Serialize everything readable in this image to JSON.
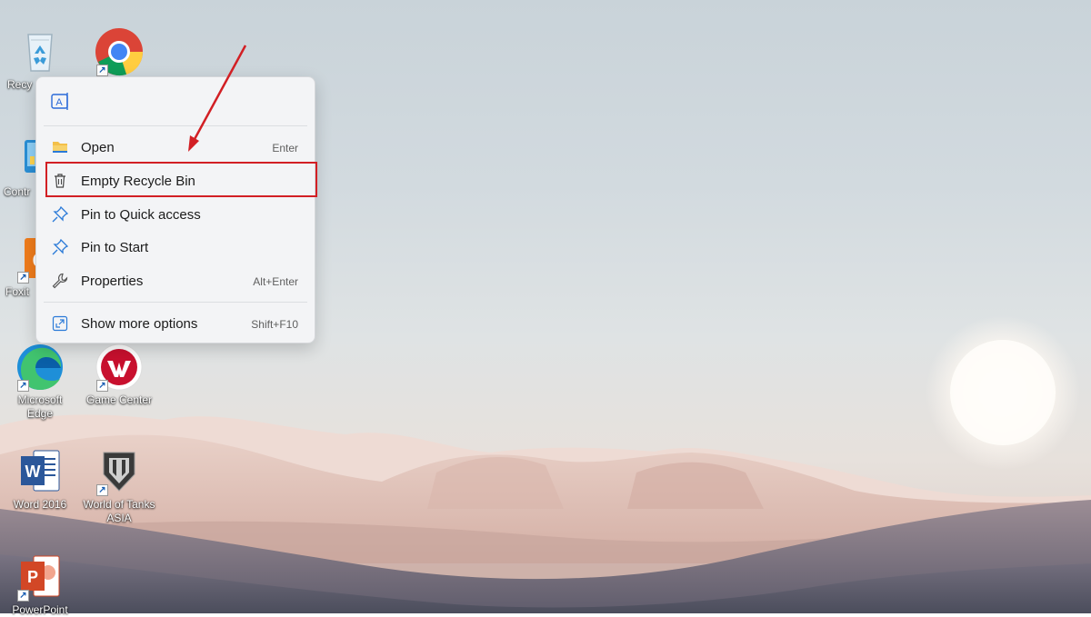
{
  "desktop": {
    "icons": [
      {
        "id": "recycle-bin",
        "label": "Recy"
      },
      {
        "id": "chrome",
        "label": ""
      },
      {
        "id": "control-panel",
        "label": "Contr"
      },
      {
        "id": "foxit",
        "label": "Foxit"
      },
      {
        "id": "edge",
        "label": "Microsoft Edge"
      },
      {
        "id": "game-center",
        "label": "Game Center"
      },
      {
        "id": "word",
        "label": "Word 2016"
      },
      {
        "id": "world-of-tanks",
        "label": "World of Tanks ASIA"
      },
      {
        "id": "powerpoint",
        "label": "PowerPoint"
      }
    ]
  },
  "context_menu": {
    "items": [
      {
        "label": "Open",
        "shortcut": "Enter",
        "icon": "folder-icon"
      },
      {
        "label": "Empty Recycle Bin",
        "shortcut": "",
        "icon": "trash-icon"
      },
      {
        "label": "Pin to Quick access",
        "shortcut": "",
        "icon": "pin-icon"
      },
      {
        "label": "Pin to Start",
        "shortcut": "",
        "icon": "pin-icon"
      },
      {
        "label": "Properties",
        "shortcut": "Alt+Enter",
        "icon": "wrench-icon"
      },
      {
        "label": "Show more options",
        "shortcut": "Shift+F10",
        "icon": "expand-icon"
      }
    ]
  },
  "annotation": {
    "highlight_color": "#d21f24"
  }
}
